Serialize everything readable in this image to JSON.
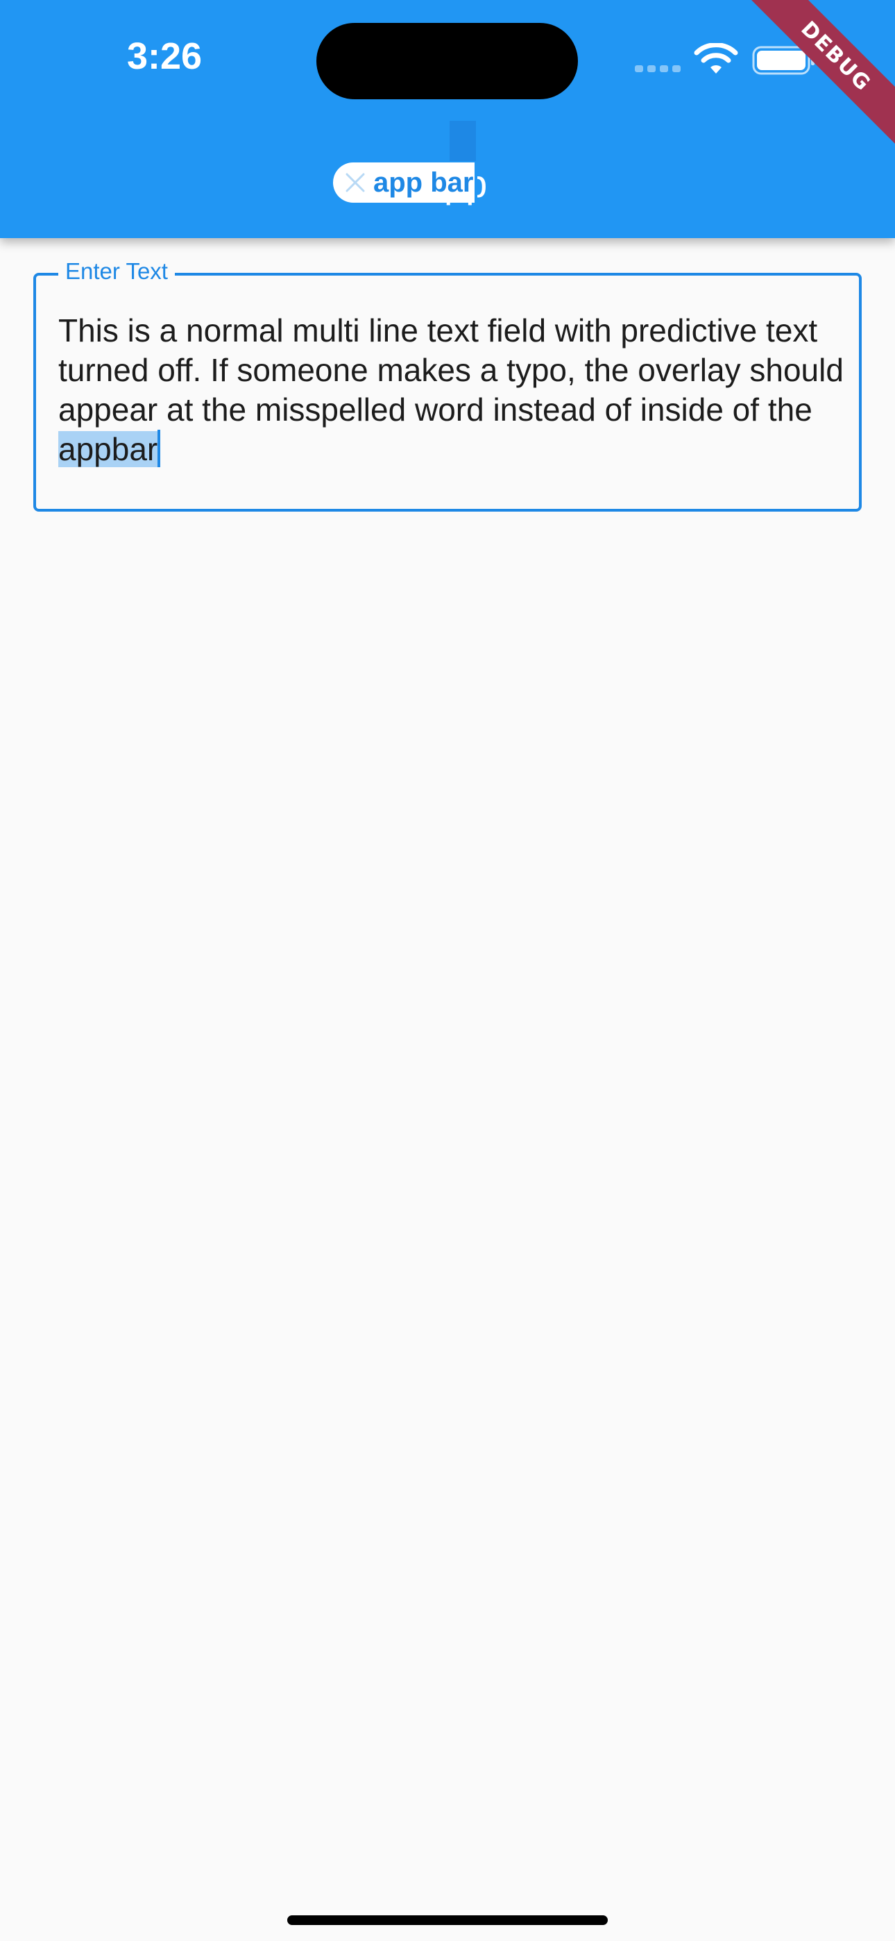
{
  "status_bar": {
    "time": "3:26"
  },
  "debug_banner": {
    "label": "DEBUG"
  },
  "app_bar": {
    "title_visible_fragment": "pp",
    "suggestion": {
      "text": "app bar",
      "icon": "close-icon"
    }
  },
  "text_field": {
    "label": "Enter Text",
    "value_before_selection": "This is a normal multi line text field with predictive text turned off. If someone makes a typo, the overlay should appear at the misspelled word instead of inside of the ",
    "selected_word": "appbar"
  },
  "colors": {
    "app_bar": "#2196f3",
    "accent": "#1e88e5",
    "background": "#fafafa",
    "selection": "#a9d2f5",
    "debug_banner": "#a03250"
  }
}
